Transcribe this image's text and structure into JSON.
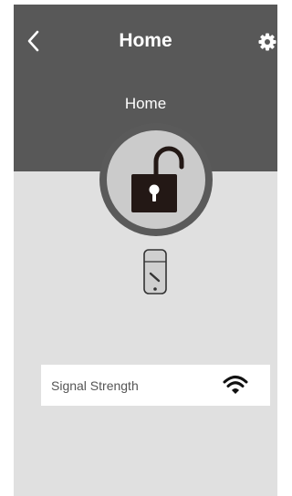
{
  "header": {
    "title": "Home",
    "back_icon": "chevron-left-icon",
    "settings_icon": "gear-icon"
  },
  "lock": {
    "name": "Home",
    "state_icon": "unlocked-padlock-icon",
    "device_icon": "smart-lock-device-icon"
  },
  "signal": {
    "label": "Signal Strength",
    "icon": "wifi-icon"
  },
  "colors": {
    "header_bg": "#585858",
    "body_bg": "#e0e0e0",
    "lock_ring": "#5a5a5a",
    "lock_inner": "#cbcbcb",
    "padlock": "#231815"
  }
}
